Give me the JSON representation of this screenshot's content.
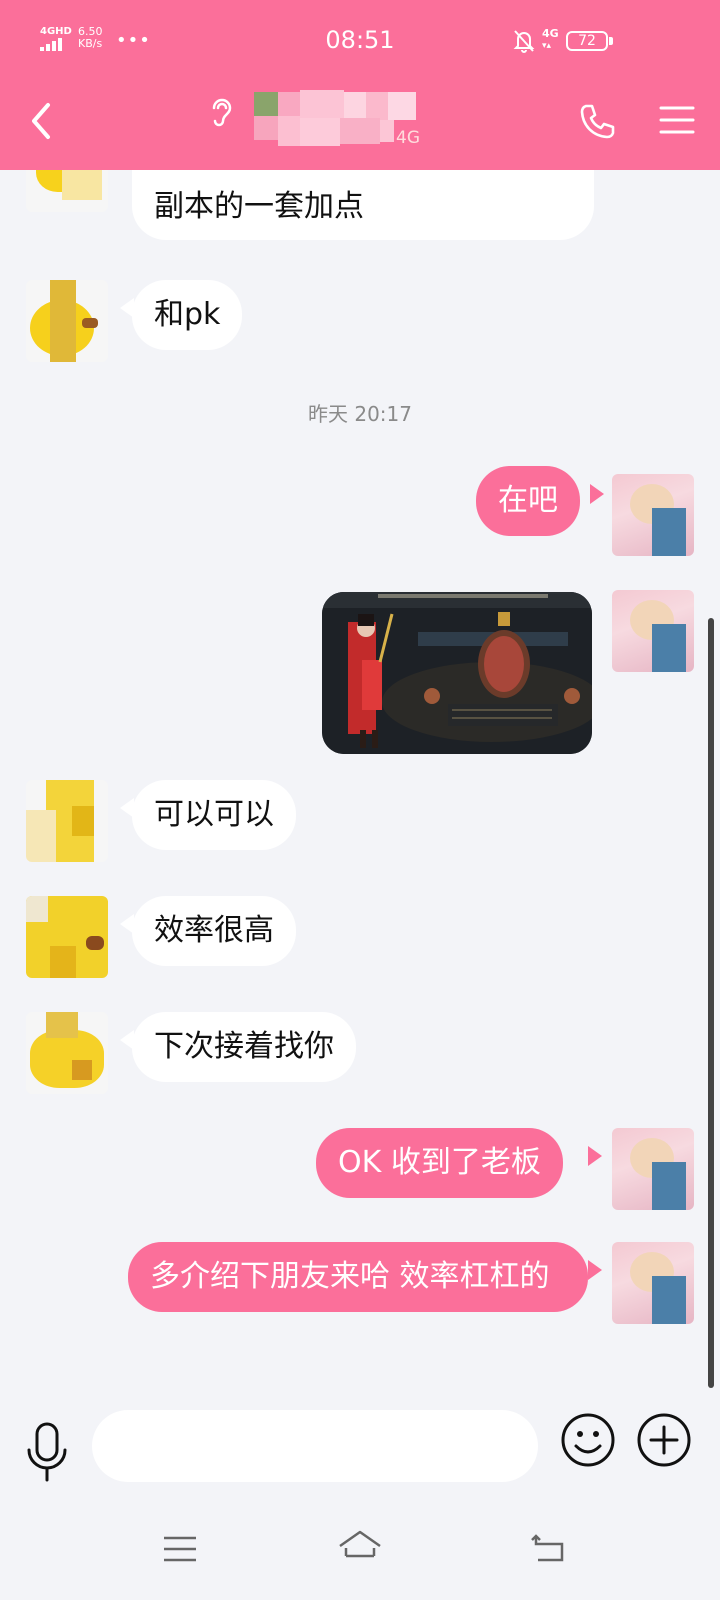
{
  "status_bar": {
    "signal_label": "4GHD",
    "net_speed_value": "6.50",
    "net_speed_unit": "KB/s",
    "overflow_dots": "•••",
    "time": "08:51",
    "network": "4G",
    "battery": "72"
  },
  "header": {
    "network_type": "4G",
    "accent_color": "#fb6f9a"
  },
  "messages": [
    {
      "side": "in",
      "text": "副本的一套加点"
    },
    {
      "side": "in",
      "text": "和pk"
    },
    {
      "side": "divider",
      "text": "昨天 20:17"
    },
    {
      "side": "out",
      "text": "在吧"
    },
    {
      "side": "out",
      "type": "image"
    },
    {
      "side": "in",
      "text": "可以可以"
    },
    {
      "side": "in",
      "text": "效率很高"
    },
    {
      "side": "in",
      "text": "下次接着找你"
    },
    {
      "side": "out",
      "text": "OK 收到了老板"
    },
    {
      "side": "out",
      "text": "多介绍下朋友来哈 效率杠杠的"
    }
  ],
  "input": {
    "value": ""
  },
  "icons": {
    "back": "chevron-left-icon",
    "ear": "ear-icon",
    "call": "phone-icon",
    "menu": "hamburger-menu-icon",
    "voice": "microphone-icon",
    "emoji": "smiley-icon",
    "plus": "plus-circle-icon"
  }
}
